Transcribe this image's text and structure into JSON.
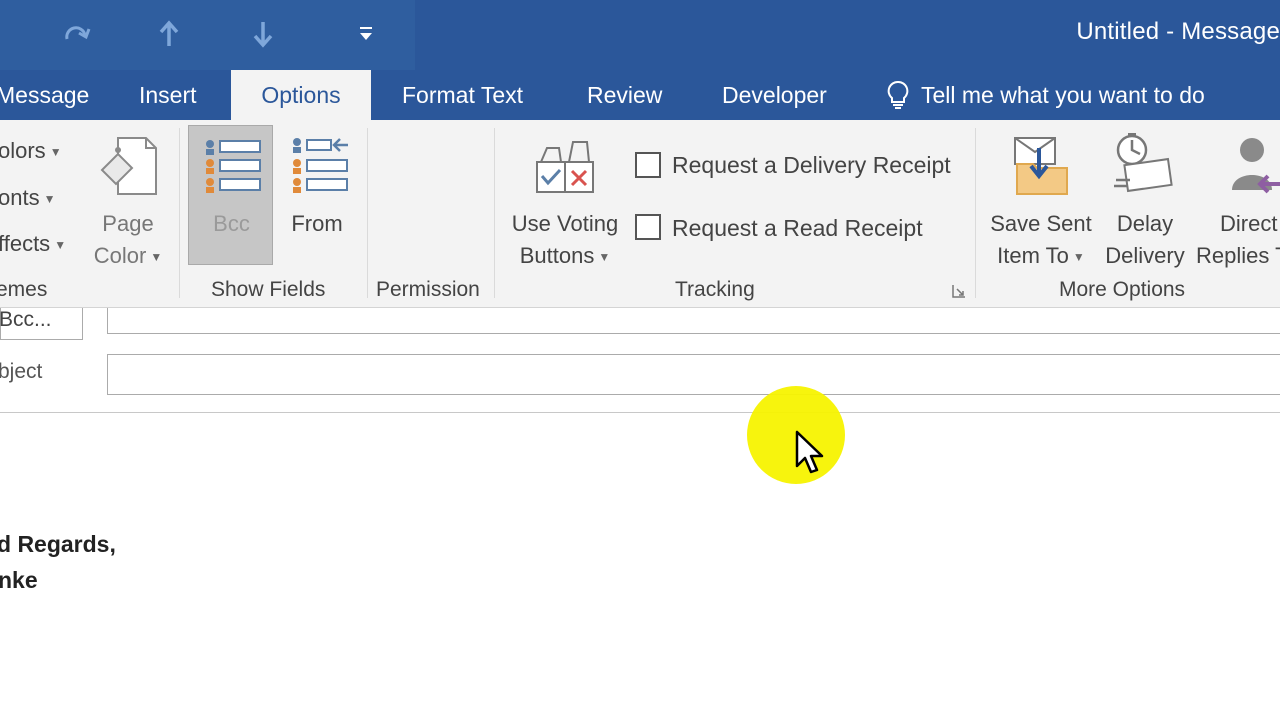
{
  "window": {
    "title": "Untitled - Message"
  },
  "quick_access": [
    {
      "name": "redo-icon"
    },
    {
      "name": "previous-item-icon"
    },
    {
      "name": "next-item-icon"
    },
    {
      "name": "customize-qat-icon"
    }
  ],
  "tabs": {
    "message": "Message",
    "insert": "Insert",
    "options": "Options",
    "format_text": "Format Text",
    "review": "Review",
    "developer": "Developer"
  },
  "tell_me": {
    "label": "Tell me what you want to do",
    "icon": "lightbulb-icon"
  },
  "ribbon": {
    "themes": {
      "colors": "olors",
      "fonts": "onts",
      "effects": "ffects",
      "page_color_line1": "Page",
      "page_color_line2": "Color",
      "group_label": "emes"
    },
    "show_fields": {
      "bcc": "Bcc",
      "from": "From",
      "group_label": "Show Fields"
    },
    "permission": {
      "group_label": "Permission"
    },
    "tracking": {
      "voting_line1": "Use Voting",
      "voting_line2": "Buttons",
      "delivery_receipt": "Request a Delivery Receipt",
      "read_receipt": "Request a Read Receipt",
      "group_label": "Tracking"
    },
    "more_options": {
      "save_sent_line1": "Save Sent",
      "save_sent_line2": "Item To",
      "delay_line1": "Delay",
      "delay_line2": "Delivery",
      "direct_line1": "Direct",
      "direct_line2": "Replies T",
      "group_label": "More Options"
    }
  },
  "message": {
    "bcc_button": "Bcc...",
    "subject_label": "bject",
    "body_line1": "d Regards,",
    "body_line2": "nke"
  },
  "colors": {
    "accent": "#2b579a",
    "ribbon_bg": "#f3f3f3",
    "highlight": "#f7f300"
  }
}
